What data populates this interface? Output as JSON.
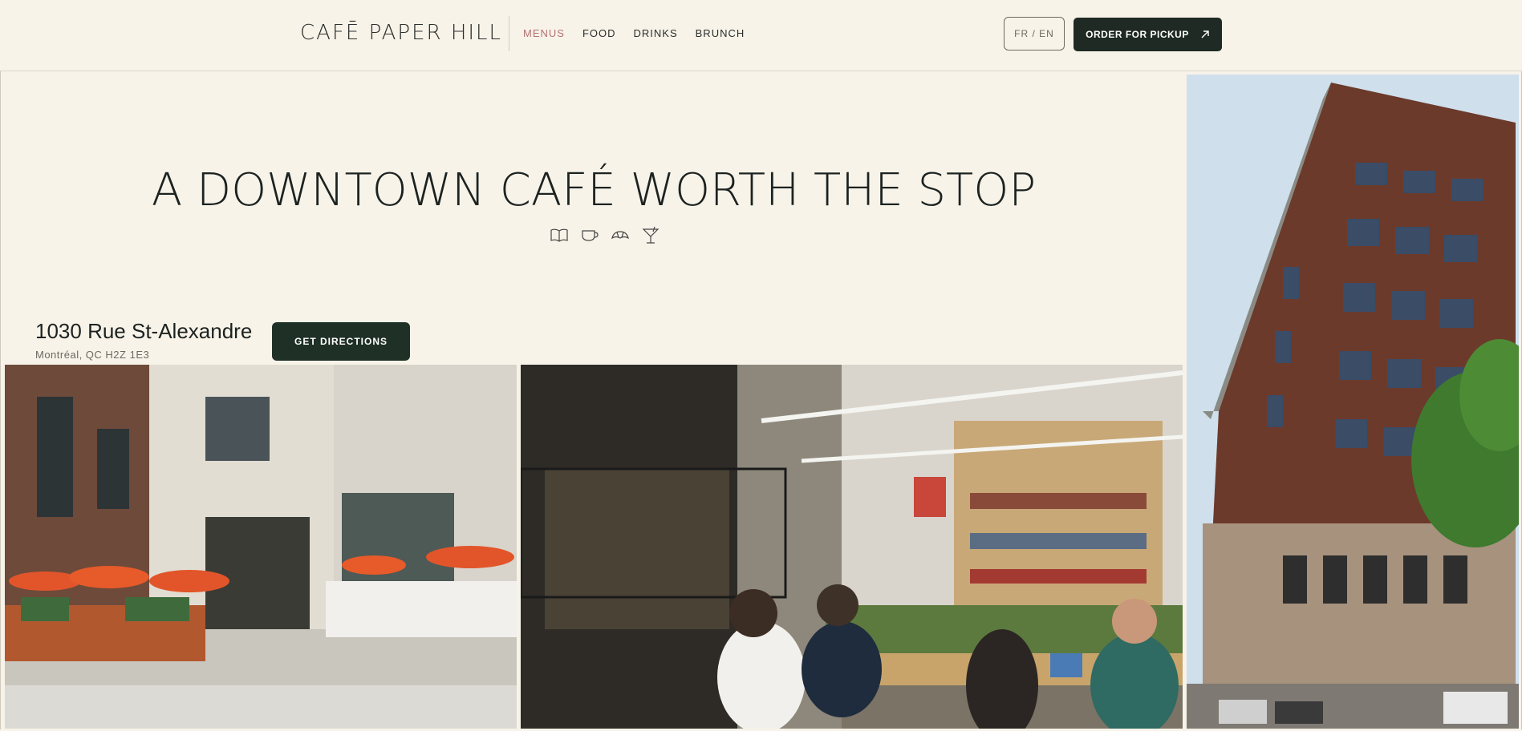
{
  "header": {
    "logo": "CAFĒ PAPER HILL",
    "nav": [
      {
        "label": "MENUS",
        "active": true
      },
      {
        "label": "FOOD",
        "active": false
      },
      {
        "label": "DRINKS",
        "active": false
      },
      {
        "label": "BRUNCH",
        "active": false
      }
    ],
    "lang_toggle": "FR / EN",
    "order_button": "ORDER FOR PICKUP"
  },
  "hero": {
    "title": "A DOWNTOWN CAFÉ WORTH THE STOP",
    "icons": [
      "book-icon",
      "coffee-cup-icon",
      "croissant-icon",
      "cocktail-icon"
    ]
  },
  "location": {
    "address": "1030 Rue St-Alexandre",
    "city": "Montréal, QC H2Z 1E3",
    "directions_button": "GET DIRECTIONS"
  },
  "colors": {
    "background": "#f7f3e9",
    "primary_dark": "#1f2a24",
    "nav_active": "#b37272"
  }
}
